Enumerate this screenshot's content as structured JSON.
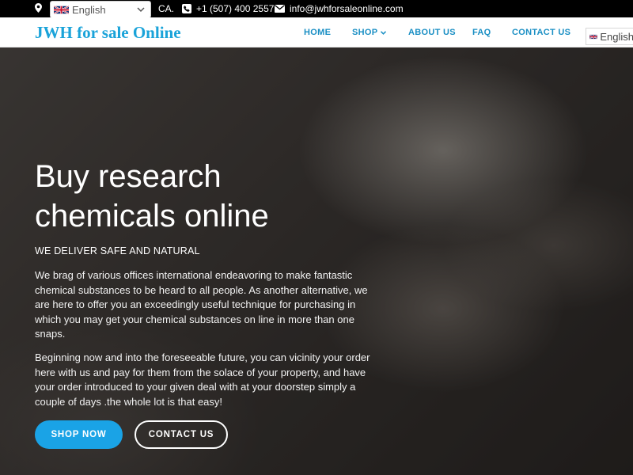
{
  "topbar": {
    "address": "CA.",
    "phone": "+1 (507) 400 2557",
    "email": "info@jwhforsaleonline.com",
    "language": "English"
  },
  "nav": {
    "logo": "JWH for sale Online",
    "items": [
      "HOME",
      "SHOP",
      "ABOUT US",
      "FAQ",
      "CONTACT US"
    ],
    "language": "English"
  },
  "hero": {
    "title": "Buy research chemicals online",
    "subtitle": "WE DELIVER SAFE AND NATURAL",
    "paragraph1": "We brag of various offices international endeavoring to make fantastic chemical substances to be heard to all people. As another alternative, we are here to offer you an exceedingly useful technique for purchasing in which you may get your chemical substances on line in more than one snaps.",
    "paragraph2": "Beginning now and into the foreseeable future, you can vicinity your order here with us and pay for them from the solace of your property, and have your order introduced to your given deal with at your doorstep simply a couple of days .the whole lot is that easy!",
    "shop_button": "SHOP NOW",
    "contact_button": "CONTACT US"
  },
  "colors": {
    "accent": "#1aa3e6",
    "logo": "#1aa3d9",
    "topbar": "#000000"
  }
}
